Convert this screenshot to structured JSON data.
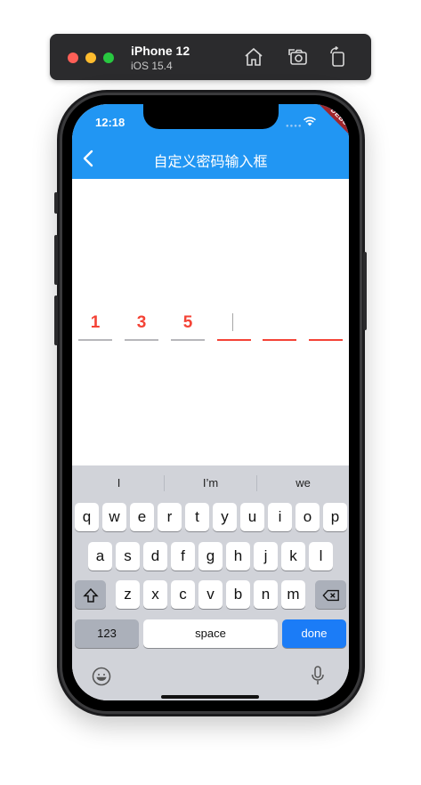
{
  "simulator": {
    "device": "iPhone 12",
    "os": "iOS 15.4",
    "icons": [
      "home-icon",
      "screenshot-icon",
      "rotate-icon"
    ]
  },
  "status_bar": {
    "time": "12:18",
    "debug_banner": "DEBUG"
  },
  "app_bar": {
    "title": "自定义密码输入框",
    "back_icon": "chevron-left-icon",
    "color": "#2196f3"
  },
  "code_input": {
    "length": 6,
    "digits": [
      "1",
      "3",
      "5",
      "",
      "",
      ""
    ],
    "active_index": 3,
    "digit_color": "#f44336"
  },
  "keyboard": {
    "suggestions": [
      "I",
      "I’m",
      "we"
    ],
    "row1": [
      "q",
      "w",
      "e",
      "r",
      "t",
      "y",
      "u",
      "i",
      "o",
      "p"
    ],
    "row2": [
      "a",
      "s",
      "d",
      "f",
      "g",
      "h",
      "j",
      "k",
      "l"
    ],
    "row3": [
      "z",
      "x",
      "c",
      "v",
      "b",
      "n",
      "m"
    ],
    "numbers_label": "123",
    "space_label": "space",
    "done_label": "done"
  }
}
